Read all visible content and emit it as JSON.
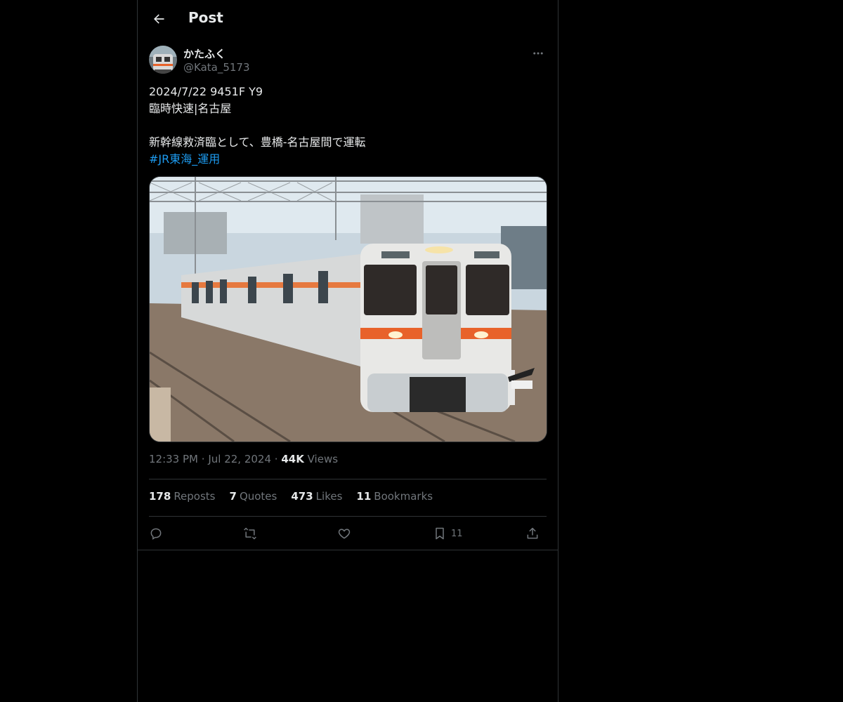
{
  "header": {
    "title": "Post",
    "back_icon": "arrow-left-icon"
  },
  "author": {
    "display_name": "かたふく",
    "handle": "@Kata_5173",
    "more_icon": "ellipsis-icon"
  },
  "tweet": {
    "lines": [
      "2024/7/22 9451F Y9",
      "臨時快速|名古屋",
      "",
      "新幹線救済臨として、豊橋-名古屋間で運転"
    ],
    "hashtag": "#JR東海_運用",
    "media_alt": "orange-striped train photo"
  },
  "meta": {
    "time": "12:33 PM",
    "separator": "·",
    "date": "Jul 22, 2024",
    "views_count": "44K",
    "views_label": "Views"
  },
  "stats": {
    "reposts_count": "178",
    "reposts_label": "Reposts",
    "quotes_count": "7",
    "quotes_label": "Quotes",
    "likes_count": "473",
    "likes_label": "Likes",
    "bookmarks_count": "11",
    "bookmarks_label": "Bookmarks"
  },
  "actions": {
    "reply_icon": "reply-icon",
    "repost_icon": "repost-icon",
    "like_icon": "heart-icon",
    "bookmark_icon": "bookmark-icon",
    "bookmark_count": "11",
    "share_icon": "share-icon"
  },
  "colors": {
    "background": "#000000",
    "text": "#e7e9ea",
    "muted": "#71767b",
    "link": "#1d9bf0",
    "border": "#2f3336"
  }
}
